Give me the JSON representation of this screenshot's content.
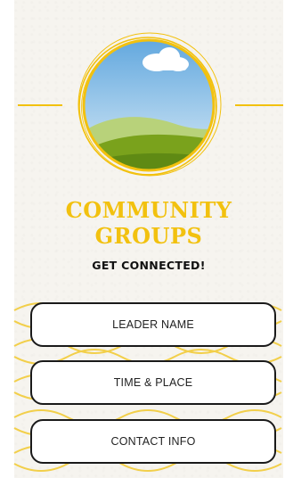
{
  "title": {
    "line1": "COMMUNITY",
    "line2": "GROUPS"
  },
  "subtitle": "GET CONNECTED!",
  "buttons": [
    {
      "label": "LEADER NAME"
    },
    {
      "label": "TIME & PLACE"
    },
    {
      "label": "CONTACT INFO"
    }
  ],
  "hero_image": {
    "icon": "landscape-icon",
    "sky_color": "#7fb8e4",
    "hill_color": "#7aa21c"
  },
  "colors": {
    "accent": "#f2c10f",
    "ink": "#1a1a1a",
    "paper": "#f6f4ef"
  }
}
